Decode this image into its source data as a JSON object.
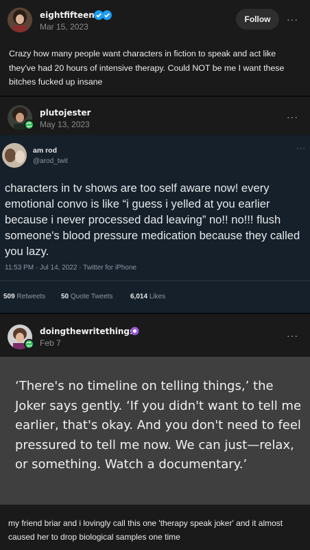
{
  "post1": {
    "username": "eightfifteen",
    "date": "Mar 15, 2023",
    "follow_label": "Follow",
    "more_label": "···",
    "body": "Crazy how many people want characters in fiction to speak and act like they've had 20 hours of intensive therapy. Could NOT be me I want these bitches fucked up insane"
  },
  "post2": {
    "username": "plutojester",
    "date": "May 13, 2023",
    "more_label": "···"
  },
  "tweet": {
    "display_name": "am rod",
    "handle": "@arod_twit",
    "more_label": "···",
    "body": "characters in tv shows are too self aware now! every emotional convo is like “i guess i yelled at you earlier because i never processed dad leaving” no!! no!!! flush someone's blood pressure medication because they called you lazy.",
    "meta": "11:53 PM · Jul 14, 2022 · Twitter for iPhone",
    "stats": [
      {
        "count": "509",
        "label": "Retweets"
      },
      {
        "count": "50",
        "label": "Quote Tweets"
      },
      {
        "count": "6,014",
        "label": "Likes"
      }
    ]
  },
  "post3": {
    "username": "doingthewritethings",
    "date": "Feb 7",
    "more_label": "···",
    "quote": "‘There's no timeline on telling things,’ the Joker says gently. ‘If you didn't want to tell me earlier, that's okay. And you don't need to feel pressured to tell me now. We can just—relax, or something. Watch a documentary.’",
    "caption": "my friend briar and i lovingly call this one 'therapy speak joker' and it almost caused her to drop biological samples one time"
  },
  "colors": {
    "background": "#1a1a1a",
    "tweet_bg": "#15202b",
    "quote_bg": "#3f3f3f",
    "reblog_green": "#2fbd56",
    "verified_blue": "#1d9bf0",
    "badge_purple": "#9b59d6"
  },
  "icons": [
    "verified-badge-icon",
    "reblog-icon",
    "more-icon",
    "tumblr-blue-check-icon",
    "purple-badge-icon"
  ]
}
